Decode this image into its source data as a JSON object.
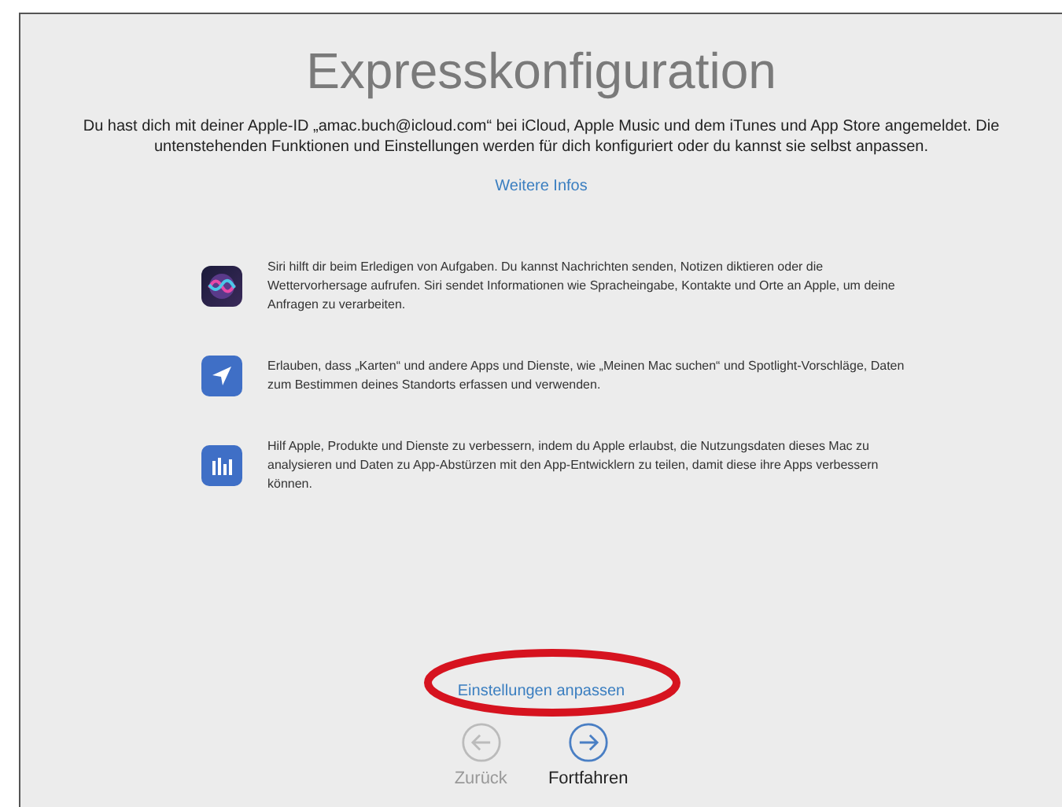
{
  "window": {
    "title": "Expresskonfiguration"
  },
  "intro": "Du hast dich mit deiner Apple-ID „amac.buch@icloud.com“ bei iCloud, Apple Music und dem iTunes und App Store angemeldet. Die untenstehenden Funktionen und Einstellungen werden für dich konfiguriert oder du kannst sie selbst anpassen.",
  "more_link": "Weitere Infos",
  "features": [
    {
      "kind": "siri",
      "text": "Siri hilft dir beim Erledigen von Aufgaben. Du kannst Nachrichten senden, Notizen diktieren oder die Wettervorhersage aufrufen. Siri sendet Informationen wie Spracheingabe, Kontakte und Orte an Apple, um deine Anfragen zu verarbeiten."
    },
    {
      "kind": "location",
      "text": "Erlauben, dass „Karten“ und andere Apps und Dienste, wie „Meinen Mac suchen“ und Spotlight-Vorschläge, Daten zum Bestimmen deines Standorts erfassen und verwenden."
    },
    {
      "kind": "analytics",
      "text": "Hilf Apple, Produkte und Dienste zu verbessern, indem du Apple erlaubst, die Nutzungsdaten dieses Mac zu analysieren und Daten zu App-Abstürzen mit den App-Entwicklern zu teilen, damit diese ihre Apps verbessern können."
    }
  ],
  "customize_link": {
    "label": "Einstellungen anpassen",
    "highlighted": true
  },
  "buttons": [
    {
      "kind": "back",
      "label": "Zurück",
      "disabled": true
    },
    {
      "kind": "forward",
      "label": "Fortfahren",
      "disabled": false
    }
  ]
}
